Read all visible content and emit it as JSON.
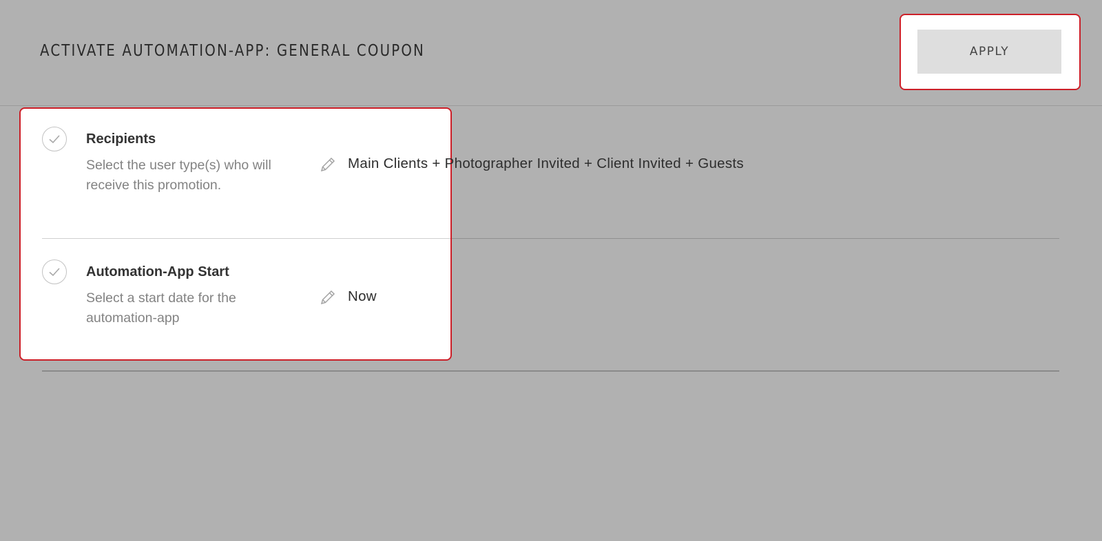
{
  "header": {
    "title": "ACTIVATE AUTOMATION-APP: GENERAL COUPON",
    "apply_label": "APPLY"
  },
  "steps": [
    {
      "title": "Recipients",
      "description": "Select the user type(s) who will receive this promotion.",
      "value": "Main Clients + Photographer Invited + Client Invited + Guests",
      "status_icon": "check-icon",
      "edit_icon": "pencil-icon"
    },
    {
      "title": "Automation-App Start",
      "description": "Select a start date for the automation-app",
      "value": "Now",
      "status_icon": "check-icon",
      "edit_icon": "pencil-icon"
    }
  ],
  "colors": {
    "overlay_background": "#b1b1b1",
    "highlight_border": "#cc1f28",
    "button_background": "#dedede"
  }
}
